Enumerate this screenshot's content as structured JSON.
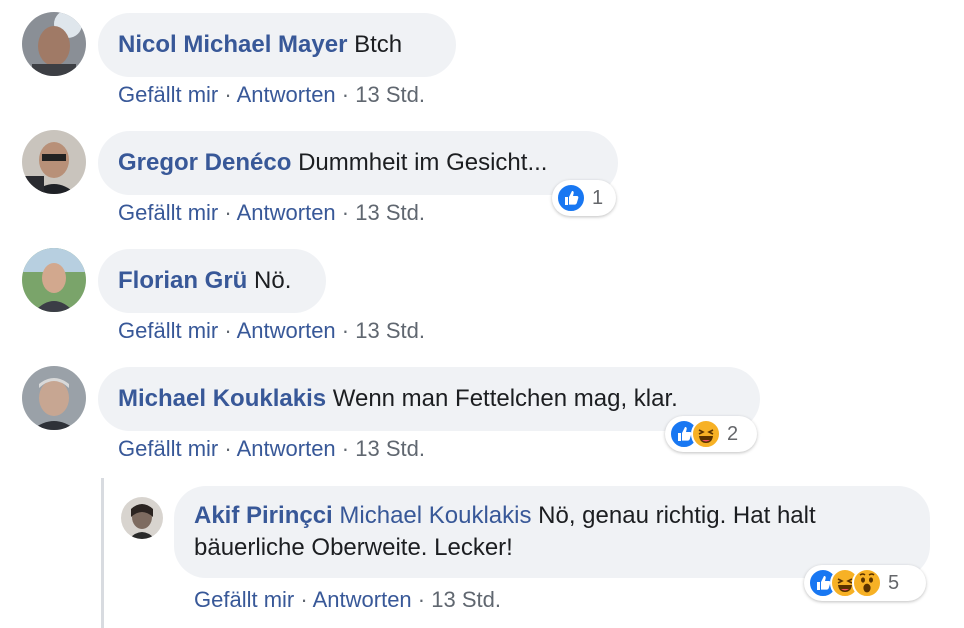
{
  "comments": [
    {
      "author": "Nicol Michael Mayer",
      "text": "Btch",
      "like": "Gefällt mir",
      "reply": "Antworten",
      "time": "13 Std."
    },
    {
      "author": "Gregor Denéco",
      "text": "Dummheit im Gesicht...",
      "like": "Gefällt mir",
      "reply": "Antworten",
      "time": "13 Std.",
      "reaction_count": "1"
    },
    {
      "author": "Florian Grü",
      "text": "Nö.",
      "like": "Gefällt mir",
      "reply": "Antworten",
      "time": "13 Std."
    },
    {
      "author": "Michael Kouklakis",
      "text": "Wenn man Fettelchen mag, klar.",
      "like": "Gefällt mir",
      "reply": "Antworten",
      "time": "13 Std.",
      "reaction_count": "2"
    }
  ],
  "reply": {
    "author": "Akif Pirinçci",
    "mention": "Michael Kouklakis",
    "text": "Nö, genau richtig. Hat halt bäuerliche Oberweite. Lecker!",
    "like": "Gefällt mir",
    "reply": "Antworten",
    "time": "13 Std.",
    "reaction_count": "5"
  },
  "separator": "·",
  "colors": {
    "link": "#385898",
    "bubble": "#f0f2f5",
    "meta": "#606770",
    "like": "#1877f2",
    "emoji": "#f7b125"
  },
  "icons": [
    "like-reaction-icon",
    "haha-reaction-icon",
    "wow-reaction-icon"
  ]
}
